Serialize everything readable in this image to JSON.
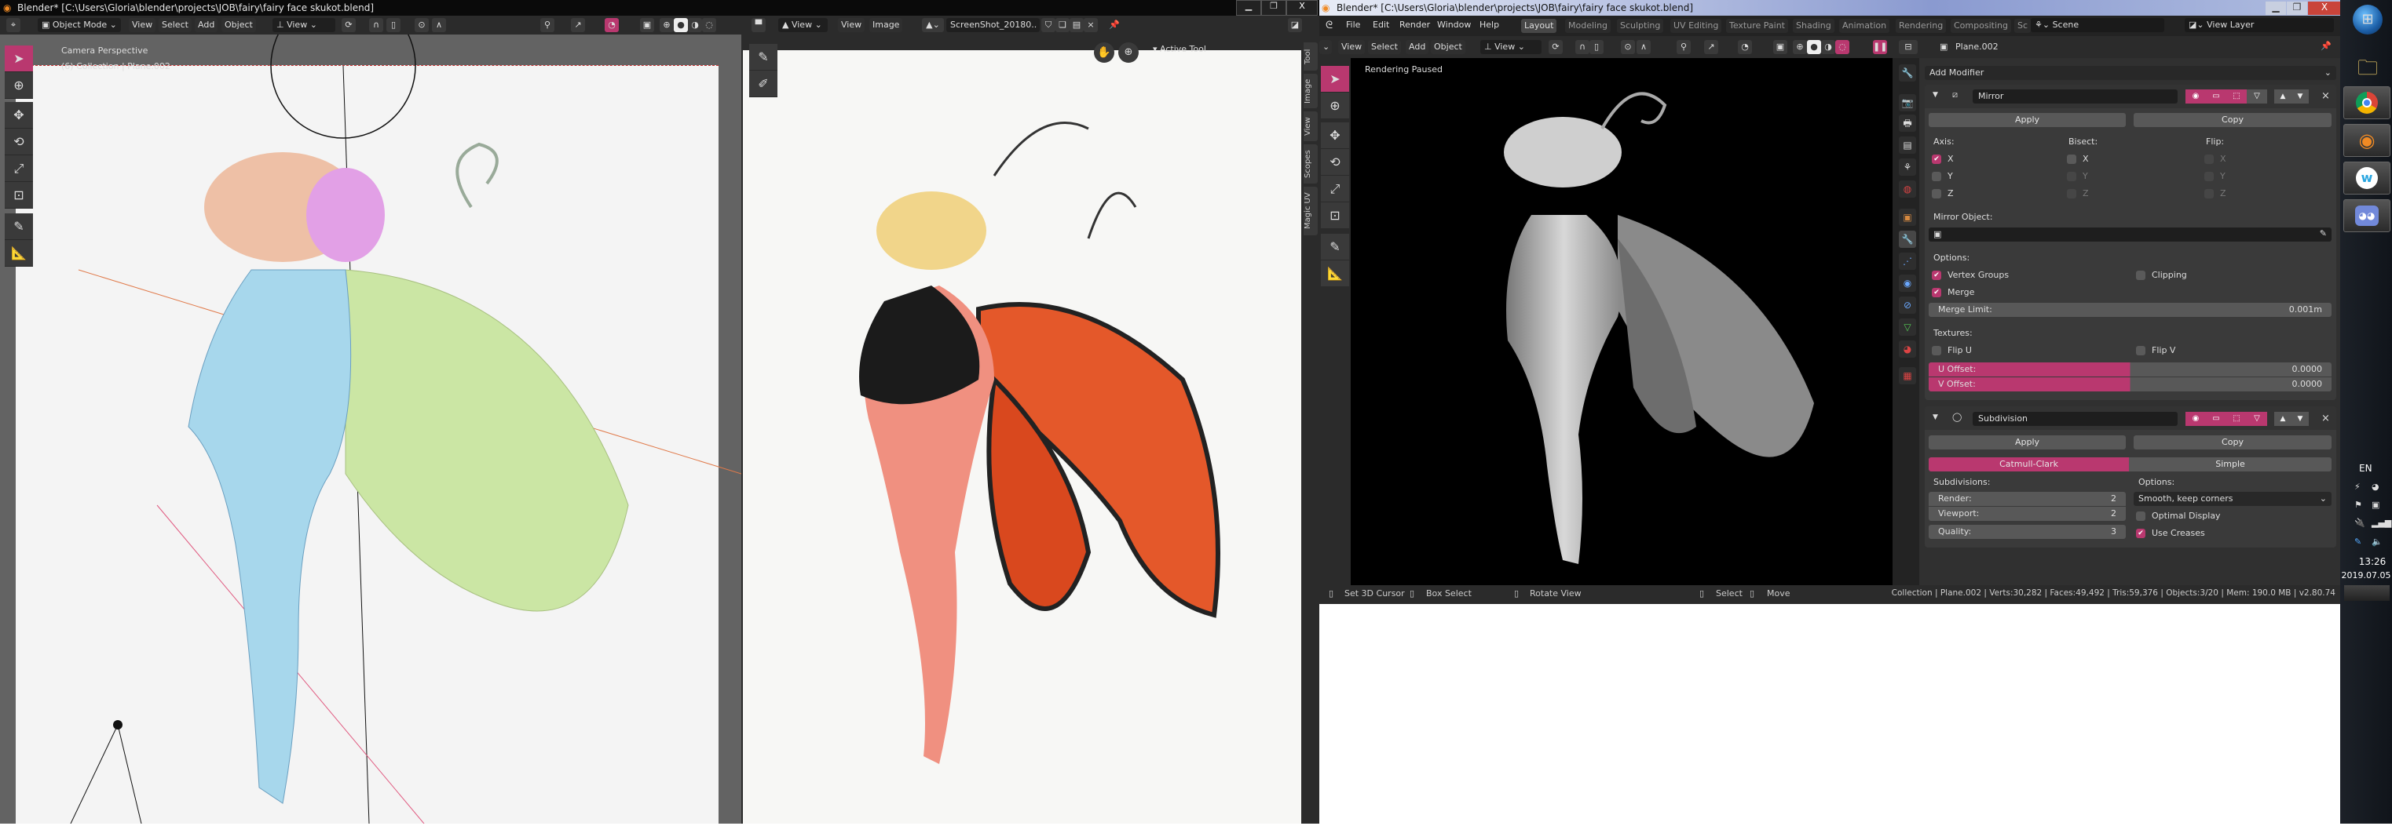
{
  "left_window": {
    "title": "Blender* [C:\\Users\\Gloria\\blender\\projects\\JOB\\fairy\\fairy face skukot.blend]",
    "viewport3d": {
      "mode": "Object Mode",
      "menus": [
        "View",
        "Select",
        "Add",
        "Object"
      ],
      "transform_orientation": "View",
      "overlay_text": [
        "Camera Perspective",
        "(6) Collection | Plane.002"
      ]
    },
    "image_editor": {
      "view_dropdown": "View",
      "menus": [
        "View",
        "Image"
      ],
      "image_name": "ScreenShot_20180..",
      "active_tool_label": "Active Tool",
      "sidebar_tabs": [
        "Tool",
        "Image",
        "View",
        "Scopes",
        "Magic UV"
      ]
    }
  },
  "right_window": {
    "title": "Blender* [C:\\Users\\Gloria\\blender\\projects\\JOB\\fairy\\fairy face skukot.blend]",
    "menus": [
      "File",
      "Edit",
      "Render",
      "Window",
      "Help"
    ],
    "workspaces": [
      "Layout",
      "Modeling",
      "Sculpting",
      "UV Editing",
      "Texture Paint",
      "Shading",
      "Animation",
      "Rendering",
      "Compositing",
      "Sc"
    ],
    "active_workspace": "Layout",
    "scene": "Scene",
    "view_layer": "View Layer",
    "viewport": {
      "menus": [
        "View",
        "Select",
        "Add",
        "Object"
      ],
      "transform_orientation": "View",
      "status_text": "Rendering Paused"
    },
    "properties": {
      "object_name": "Plane.002",
      "add_modifier": "Add Modifier",
      "mirror": {
        "name": "Mirror",
        "apply": "Apply",
        "copy": "Copy",
        "axis_label": "Axis:",
        "bisect_label": "Bisect:",
        "flip_label": "Flip:",
        "axes": [
          "X",
          "Y",
          "Z"
        ],
        "axis_checked": [
          true,
          false,
          false
        ],
        "bisect_checked": [
          false,
          false,
          false
        ],
        "flip_checked": [
          false,
          false,
          false
        ],
        "mirror_object_label": "Mirror Object:",
        "options_label": "Options:",
        "vertex_groups": "Vertex Groups",
        "vertex_groups_checked": true,
        "clipping": "Clipping",
        "clipping_checked": false,
        "merge": "Merge",
        "merge_checked": true,
        "merge_limit_label": "Merge Limit:",
        "merge_limit_value": "0.001m",
        "textures_label": "Textures:",
        "flip_u": "Flip U",
        "flip_v": "Flip V",
        "u_offset_label": "U Offset:",
        "u_offset_value": "0.0000",
        "v_offset_label": "V Offset:",
        "v_offset_value": "0.0000"
      },
      "subdivision": {
        "name": "Subdivision",
        "apply": "Apply",
        "copy": "Copy",
        "type_options": [
          "Catmull-Clark",
          "Simple"
        ],
        "active_type": "Catmull-Clark",
        "subdivisions_label": "Subdivisions:",
        "render_label": "Render:",
        "render_value": "2",
        "viewport_label": "Viewport:",
        "viewport_value": "2",
        "quality_label": "Quality:",
        "quality_value": "3",
        "options_label": "Options:",
        "uv_smooth": "Smooth, keep corners",
        "optimal_display": "Optimal Display",
        "optimal_display_checked": false,
        "use_creases": "Use Creases",
        "use_creases_checked": true
      }
    },
    "statusbar": {
      "hints": [
        "Set 3D Cursor",
        "Box Select",
        "Rotate View",
        "Select",
        "Move"
      ],
      "info": "Collection | Plane.002 | Verts:30,282 | Faces:49,492 | Tris:59,376 | Objects:3/20 | Mem: 190.0 MB | v2.80.74"
    }
  },
  "taskbar": {
    "apps": [
      "start-orb",
      "file-explorer",
      "chrome",
      "blender",
      "w-app",
      "discord"
    ],
    "language": "EN",
    "time": "13:26",
    "date": "2019.07.05"
  },
  "colors": {
    "accent": "#b9386f",
    "header": "#2b2b2b",
    "panel": "#303030",
    "button": "#585858"
  }
}
